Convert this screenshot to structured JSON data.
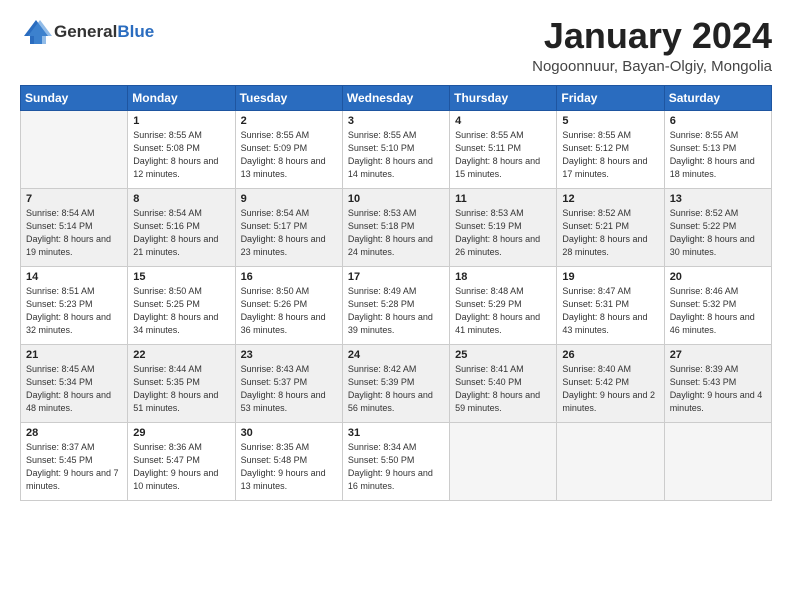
{
  "logo": {
    "general": "General",
    "blue": "Blue"
  },
  "title": "January 2024",
  "location": "Nogoonnuur, Bayan-Olgiy, Mongolia",
  "headers": [
    "Sunday",
    "Monday",
    "Tuesday",
    "Wednesday",
    "Thursday",
    "Friday",
    "Saturday"
  ],
  "weeks": [
    [
      {
        "day": "",
        "empty": true
      },
      {
        "day": "1",
        "sunrise": "Sunrise: 8:55 AM",
        "sunset": "Sunset: 5:08 PM",
        "daylight": "Daylight: 8 hours and 12 minutes."
      },
      {
        "day": "2",
        "sunrise": "Sunrise: 8:55 AM",
        "sunset": "Sunset: 5:09 PM",
        "daylight": "Daylight: 8 hours and 13 minutes."
      },
      {
        "day": "3",
        "sunrise": "Sunrise: 8:55 AM",
        "sunset": "Sunset: 5:10 PM",
        "daylight": "Daylight: 8 hours and 14 minutes."
      },
      {
        "day": "4",
        "sunrise": "Sunrise: 8:55 AM",
        "sunset": "Sunset: 5:11 PM",
        "daylight": "Daylight: 8 hours and 15 minutes."
      },
      {
        "day": "5",
        "sunrise": "Sunrise: 8:55 AM",
        "sunset": "Sunset: 5:12 PM",
        "daylight": "Daylight: 8 hours and 17 minutes."
      },
      {
        "day": "6",
        "sunrise": "Sunrise: 8:55 AM",
        "sunset": "Sunset: 5:13 PM",
        "daylight": "Daylight: 8 hours and 18 minutes."
      }
    ],
    [
      {
        "day": "7",
        "sunrise": "Sunrise: 8:54 AM",
        "sunset": "Sunset: 5:14 PM",
        "daylight": "Daylight: 8 hours and 19 minutes."
      },
      {
        "day": "8",
        "sunrise": "Sunrise: 8:54 AM",
        "sunset": "Sunset: 5:16 PM",
        "daylight": "Daylight: 8 hours and 21 minutes."
      },
      {
        "day": "9",
        "sunrise": "Sunrise: 8:54 AM",
        "sunset": "Sunset: 5:17 PM",
        "daylight": "Daylight: 8 hours and 23 minutes."
      },
      {
        "day": "10",
        "sunrise": "Sunrise: 8:53 AM",
        "sunset": "Sunset: 5:18 PM",
        "daylight": "Daylight: 8 hours and 24 minutes."
      },
      {
        "day": "11",
        "sunrise": "Sunrise: 8:53 AM",
        "sunset": "Sunset: 5:19 PM",
        "daylight": "Daylight: 8 hours and 26 minutes."
      },
      {
        "day": "12",
        "sunrise": "Sunrise: 8:52 AM",
        "sunset": "Sunset: 5:21 PM",
        "daylight": "Daylight: 8 hours and 28 minutes."
      },
      {
        "day": "13",
        "sunrise": "Sunrise: 8:52 AM",
        "sunset": "Sunset: 5:22 PM",
        "daylight": "Daylight: 8 hours and 30 minutes."
      }
    ],
    [
      {
        "day": "14",
        "sunrise": "Sunrise: 8:51 AM",
        "sunset": "Sunset: 5:23 PM",
        "daylight": "Daylight: 8 hours and 32 minutes."
      },
      {
        "day": "15",
        "sunrise": "Sunrise: 8:50 AM",
        "sunset": "Sunset: 5:25 PM",
        "daylight": "Daylight: 8 hours and 34 minutes."
      },
      {
        "day": "16",
        "sunrise": "Sunrise: 8:50 AM",
        "sunset": "Sunset: 5:26 PM",
        "daylight": "Daylight: 8 hours and 36 minutes."
      },
      {
        "day": "17",
        "sunrise": "Sunrise: 8:49 AM",
        "sunset": "Sunset: 5:28 PM",
        "daylight": "Daylight: 8 hours and 39 minutes."
      },
      {
        "day": "18",
        "sunrise": "Sunrise: 8:48 AM",
        "sunset": "Sunset: 5:29 PM",
        "daylight": "Daylight: 8 hours and 41 minutes."
      },
      {
        "day": "19",
        "sunrise": "Sunrise: 8:47 AM",
        "sunset": "Sunset: 5:31 PM",
        "daylight": "Daylight: 8 hours and 43 minutes."
      },
      {
        "day": "20",
        "sunrise": "Sunrise: 8:46 AM",
        "sunset": "Sunset: 5:32 PM",
        "daylight": "Daylight: 8 hours and 46 minutes."
      }
    ],
    [
      {
        "day": "21",
        "sunrise": "Sunrise: 8:45 AM",
        "sunset": "Sunset: 5:34 PM",
        "daylight": "Daylight: 8 hours and 48 minutes."
      },
      {
        "day": "22",
        "sunrise": "Sunrise: 8:44 AM",
        "sunset": "Sunset: 5:35 PM",
        "daylight": "Daylight: 8 hours and 51 minutes."
      },
      {
        "day": "23",
        "sunrise": "Sunrise: 8:43 AM",
        "sunset": "Sunset: 5:37 PM",
        "daylight": "Daylight: 8 hours and 53 minutes."
      },
      {
        "day": "24",
        "sunrise": "Sunrise: 8:42 AM",
        "sunset": "Sunset: 5:39 PM",
        "daylight": "Daylight: 8 hours and 56 minutes."
      },
      {
        "day": "25",
        "sunrise": "Sunrise: 8:41 AM",
        "sunset": "Sunset: 5:40 PM",
        "daylight": "Daylight: 8 hours and 59 minutes."
      },
      {
        "day": "26",
        "sunrise": "Sunrise: 8:40 AM",
        "sunset": "Sunset: 5:42 PM",
        "daylight": "Daylight: 9 hours and 2 minutes."
      },
      {
        "day": "27",
        "sunrise": "Sunrise: 8:39 AM",
        "sunset": "Sunset: 5:43 PM",
        "daylight": "Daylight: 9 hours and 4 minutes."
      }
    ],
    [
      {
        "day": "28",
        "sunrise": "Sunrise: 8:37 AM",
        "sunset": "Sunset: 5:45 PM",
        "daylight": "Daylight: 9 hours and 7 minutes."
      },
      {
        "day": "29",
        "sunrise": "Sunrise: 8:36 AM",
        "sunset": "Sunset: 5:47 PM",
        "daylight": "Daylight: 9 hours and 10 minutes."
      },
      {
        "day": "30",
        "sunrise": "Sunrise: 8:35 AM",
        "sunset": "Sunset: 5:48 PM",
        "daylight": "Daylight: 9 hours and 13 minutes."
      },
      {
        "day": "31",
        "sunrise": "Sunrise: 8:34 AM",
        "sunset": "Sunset: 5:50 PM",
        "daylight": "Daylight: 9 hours and 16 minutes."
      },
      {
        "day": "",
        "empty": true
      },
      {
        "day": "",
        "empty": true
      },
      {
        "day": "",
        "empty": true
      }
    ]
  ]
}
